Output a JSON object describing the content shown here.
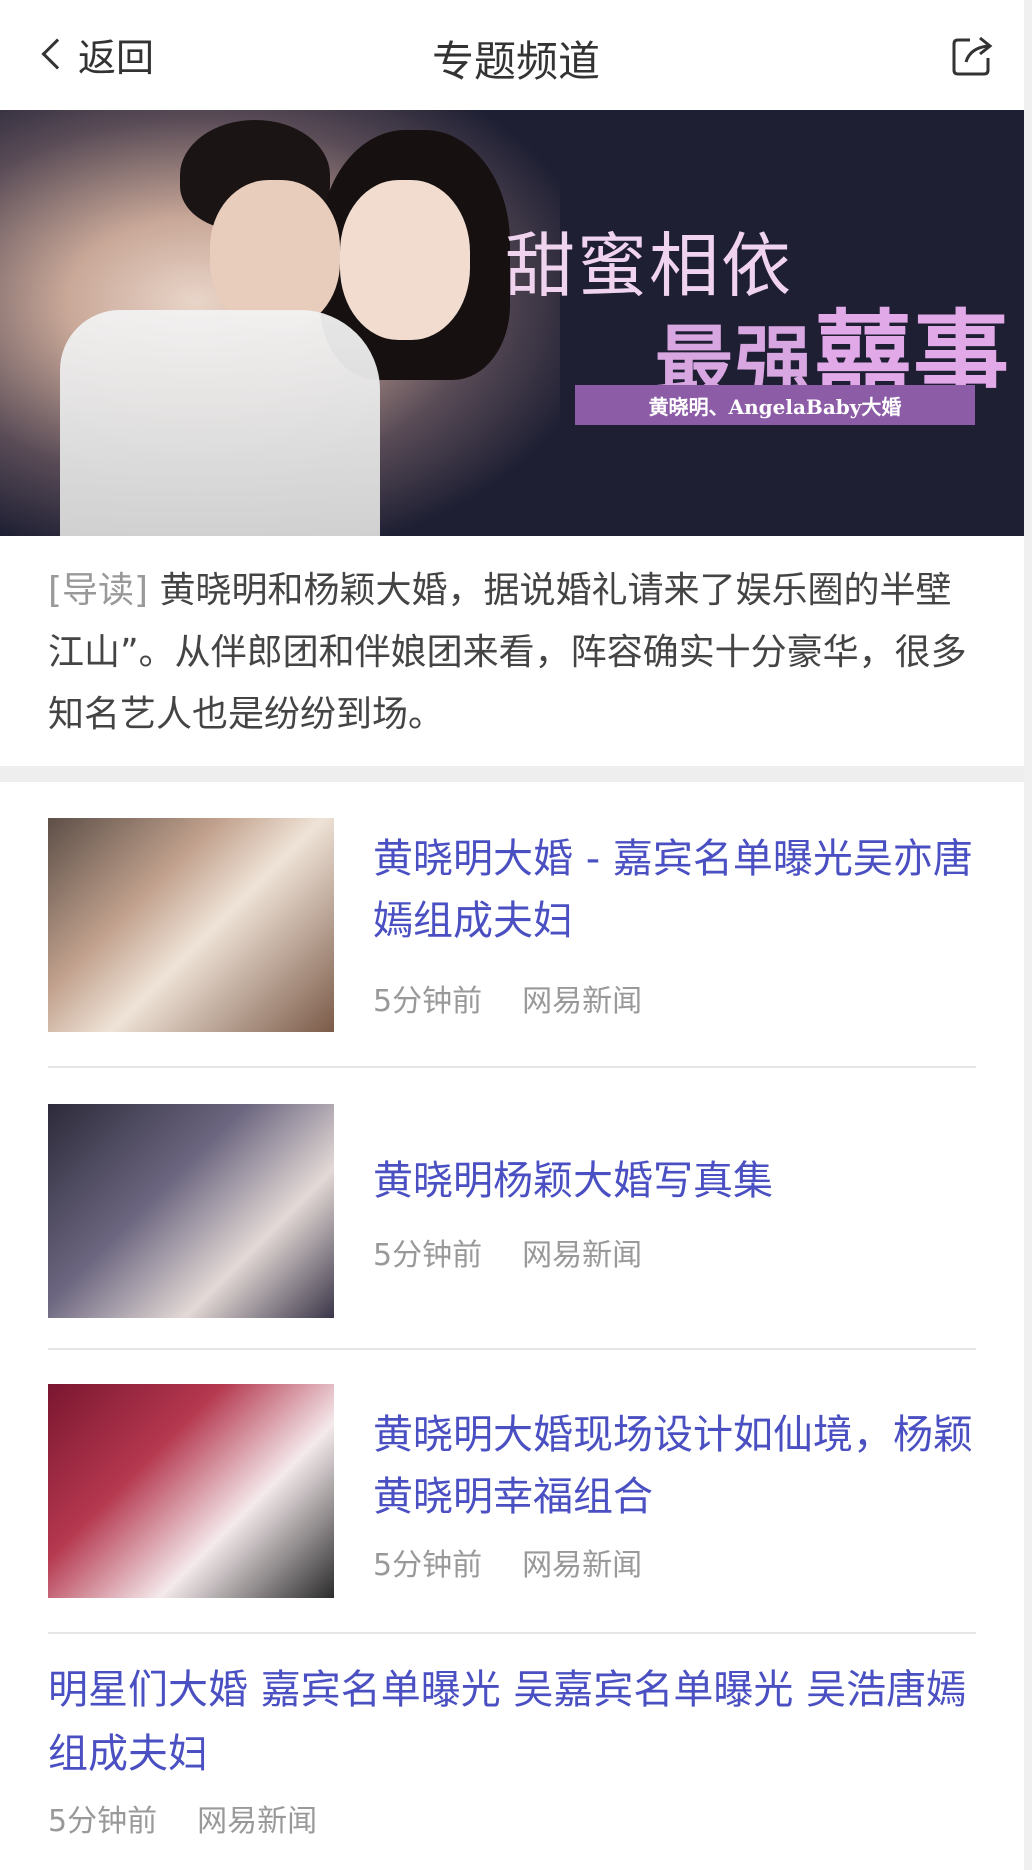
{
  "nav": {
    "back_label": "返回",
    "title": "专题频道"
  },
  "banner": {
    "headline_line1": "甜蜜相依",
    "headline_line2_small": "最强",
    "headline_line2_big": "囍事",
    "tagline": "黄晓明、AngelaBaby大婚"
  },
  "intro": {
    "tag": "[导读]",
    "text": " 黄晓明和杨颖大婚，据说婚礼请来了娱乐圈的半壁江山”。从伴郎团和伴娘团来看，阵容确实十分豪华，很多知名艺人也是纷纷到场。"
  },
  "news": [
    {
      "title": "黄晓明大婚 - 嘉宾名单曝光吴亦唐嫣组成夫妇",
      "time": "5分钟前",
      "source": "网易新闻"
    },
    {
      "title": "黄晓明杨颖大婚写真集",
      "time": "5分钟前",
      "source": "网易新闻"
    },
    {
      "title": "黄晓明大婚现场设计如仙境，杨颖黄晓明幸福组合",
      "time": "5分钟前",
      "source": "网易新闻"
    }
  ],
  "bottom_item": {
    "title": "明星们大婚  嘉宾名单曝光 吴嘉宾名单曝光 吴浩唐嫣组成夫妇",
    "time": "5分钟前",
    "source": "网易新闻"
  },
  "icons": {
    "back": "chevron-left-icon",
    "share": "share-icon"
  },
  "colors": {
    "link_title": "#4a4fc2",
    "banner_bg": "#1e1f33",
    "banner_tag": "#8c5ca6"
  }
}
